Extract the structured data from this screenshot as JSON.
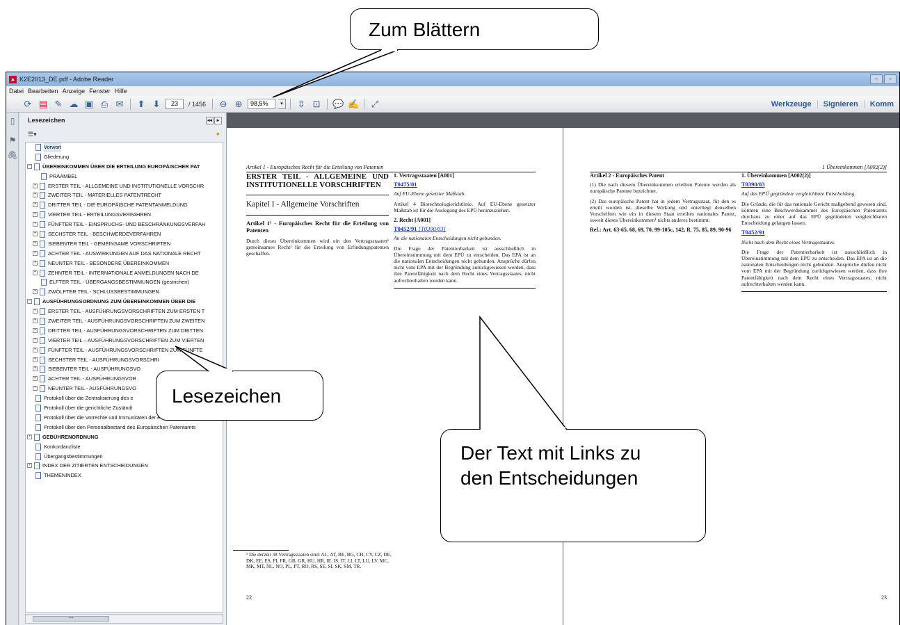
{
  "callouts": {
    "top": "Zum Blättern",
    "bookmarks": "Lesezeichen",
    "text_line1": "Der Text mit Links zu",
    "text_line2": "den Entscheidungen"
  },
  "window": {
    "title": "K2E2013_DE.pdf - Adobe Reader"
  },
  "menu": [
    "Datei",
    "Bearbeiten",
    "Anzeige",
    "Fenster",
    "Hilfe"
  ],
  "toolbar": {
    "page_current": "23",
    "page_total": "/ 1456",
    "zoom": "98,5%",
    "right": [
      "Werkzeuge",
      "Signieren",
      "Komm"
    ]
  },
  "bookmarks": {
    "title": "Lesezeichen",
    "items": [
      {
        "label": "Vorwort",
        "level": 1,
        "exp": "",
        "sel": true
      },
      {
        "label": "Gliederung",
        "level": 1,
        "exp": ""
      },
      {
        "label": "ÜBEREINKOMMEN ÜBER DIE ERTEILUNG EUROPÄISCHER PAT",
        "level": 0,
        "exp": "-",
        "bold": true
      },
      {
        "label": "PRÄAMBEL",
        "level": 2,
        "exp": ""
      },
      {
        "label": "ERSTER TEIL - ALLGEMEINE UND INSTITUTIONELLE VORSCHR",
        "level": 1,
        "exp": "+"
      },
      {
        "label": "ZWEITER TEIL - MATERIELLES PATENTRECHT",
        "level": 1,
        "exp": "+"
      },
      {
        "label": "DRITTER TEIL - DIE EUROPÄISCHE PATENTANMELDUNG",
        "level": 1,
        "exp": "+"
      },
      {
        "label": "VIERTER TEIL - ERTEILUNGSVERFAHREN",
        "level": 1,
        "exp": "+"
      },
      {
        "label": "FÜNFTER TEIL - EINSPRUCHS- UND BESCHRÄNKUNGSVERFAH",
        "level": 1,
        "exp": "+"
      },
      {
        "label": "SECHSTER TEIL - BESCHWERDEVERFAHREN",
        "level": 1,
        "exp": "+"
      },
      {
        "label": "SIEBENTER TEIL - GEMEINSAME VORSCHRIFTEN",
        "level": 1,
        "exp": "+"
      },
      {
        "label": "ACHTER TEIL - AUSWIRKUNGEN AUF DAS NATIONALE RECHT",
        "level": 1,
        "exp": "+"
      },
      {
        "label": "NEUNTER TEIL - BESONDERE ÜBEREINKOMMEN",
        "level": 1,
        "exp": "+"
      },
      {
        "label": "ZEHNTER TEIL - INTERNATIONALE ANMELDUNGEN NACH DE",
        "level": 1,
        "exp": "+"
      },
      {
        "label": "ELFTER TEIL - ÜBERGANGSBESTIMMUNGEN (gestrichen)",
        "level": 2,
        "exp": ""
      },
      {
        "label": "ZWÖLFTER TEIL - SCHLUSSBESTIMMUNGEN",
        "level": 1,
        "exp": "+"
      },
      {
        "label": "AUSFÜHRUNGSORDNUNG ZUM ÜBEREINKOMMEN ÜBER DIE",
        "level": 0,
        "exp": "-",
        "bold": true
      },
      {
        "label": "ERSTER TEIL - AUSFÜHRUNGSVORSCHRIFTEN ZUM ERSTEN T",
        "level": 1,
        "exp": "+"
      },
      {
        "label": "ZWEITER TEIL - AUSFÜHRUNGSVORSCHRIFTEN ZUM ZWEITEN",
        "level": 1,
        "exp": "+"
      },
      {
        "label": "DRITTER TEIL - AUSFÜHRUNGSVORSCHRIFTEN ZUM DRITTEN",
        "level": 1,
        "exp": "+"
      },
      {
        "label": "VIERTER TEIL – AUSFÜHRUNGSVORSCHRIFTEN ZUM VIERTEN",
        "level": 1,
        "exp": "+"
      },
      {
        "label": "FÜNFTER TEIL - AUSFÜHRUNGSVORSCHRIFTEN ZUM FÜNFTE",
        "level": 1,
        "exp": "+"
      },
      {
        "label": "SECHSTER TEIL - AUSFÜHRUNGSVORSCHRI",
        "level": 1,
        "exp": "+"
      },
      {
        "label": "SIEBENTER TEIL - AUSFÜHRUNGSVO",
        "level": 1,
        "exp": "+"
      },
      {
        "label": "ACHTER TEIL - AUSFÜHRUNGSVOR",
        "level": 1,
        "exp": "+"
      },
      {
        "label": "NEUNTER TEIL - AUSFÜHRUNGSVO",
        "level": 1,
        "exp": "+"
      },
      {
        "label": "Protokoll über die Zentralisierung des e",
        "level": 1,
        "exp": ""
      },
      {
        "label": "Protokoll über die gerichtliche Zuständi",
        "level": 1,
        "exp": ""
      },
      {
        "label": "Protokoll über die Vorrechte und Immunitäten der europäischen I",
        "level": 1,
        "exp": ""
      },
      {
        "label": "Protokoll über den Personalbestand des Europäischen Patentamts",
        "level": 1,
        "exp": ""
      },
      {
        "label": "GEBÜHRENORDNUNG",
        "level": 0,
        "exp": "+",
        "bold": true
      },
      {
        "label": "Konkordanzliste",
        "level": 1,
        "exp": ""
      },
      {
        "label": "Übergangsbestimmungen",
        "level": 1,
        "exp": ""
      },
      {
        "label": "INDEX DER ZITIERTEN ENTSCHEIDUNGEN",
        "level": 0,
        "exp": "+"
      },
      {
        "label": "THEMENINDEX",
        "level": 1,
        "exp": ""
      }
    ]
  },
  "page_left": {
    "header": "Artikel 1 - Europäisches Recht für die Erteilung von Patenten",
    "part_title": "ERSTER TEIL - ALLGEMEINE UND INSTITUTIONELLE VORSCHRIFTEN",
    "chapter": "Kapitel I - Allgemeine Vorschriften",
    "article_title": "Artikel 1¹ - Europäisches Recht für die Erteilung von Patenten",
    "article_text": "Durch dieses Übereinkommen wird ein den Vertragsstaaten¹ gemeinsames Recht¹ für die Erteilung von Erfindungspatenten geschaffen.",
    "c1_head": "1. Vertragsstaaten [A001]",
    "c1_link": "T0475/01",
    "c1_italic": "Auf EU-Ebene gesetzter Maßstab.",
    "c1_text": "Artikel 4 Biotechnologierichtlinie. Auf EU-Ebene gesetzter Maßstab ist für die Auslegung des EPÜ heranzuziehen.",
    "c2_head": "2. Recht [A001]",
    "c2_link": "T0452/91",
    "c2_link2": "[T0390/03]",
    "c2_italic": "An die nationalen Entscheidungen nicht gebunden.",
    "c2_text": "Die Frage der Patentierbarkeit ist ausschließlich in Übereinstimmung mit dem EPÜ zu entscheiden. Das EPA ist an die nationalen Entscheidungen nicht gebunden. Ansprüche dürfen nicht vom EPA mit der Begründung zurückgewiesen werden, dass ihre Patentfähigkeit nach dem Recht eines Vertragsstaates, nicht aufrechterhalten werden kann.",
    "footnote": "¹ Die derzeit 38 Vertragsstaaten sind: AL, AT, BE, BG, CH, CY, CZ, DE, DK, EE, ES, FI, FR, GB, GR, HU, HR, IE, IS, IT, LI, LT, LU, LV, MC, MK, MT, NL, NO, PL, PT, RO, RS, SE, SI, SK, SM, TR.",
    "page_number": "22"
  },
  "page_right": {
    "header": "1 Übereinkommen [A002(2)]",
    "a2_title": "Artikel 2 - Europäisches Patent",
    "a2_p1": "(1) Die nach diesem Übereinkommen erteilten Patente werden als europäische Patente bezeichnet.",
    "a2_p2": "(2) Das europäische Patent hat in jedem Vertragsstaat, für den es erteilt worden ist, dieselbe Wirkung und unterliegt denselben Vorschriften wie ein in diesem Staat erteiltes nationales Patent, soweit dieses Übereinkommen¹ nichts anderes bestimmt.",
    "a2_ref": "Ref.: Art. 63-65, 68, 69, 70, 99-105c, 142, R. 75, 85, 89, 90-96",
    "c1_head": "1. Übereinkommen [A002(2)]",
    "c1_link": "T0390/03",
    "c1_italic": "Auf das EPÜ gegründete vergleichbare Entscheidung.",
    "c1_text": "Die Gründe, die für das nationale Gericht maßgebend gewesen sind, könnten eine Beschwerdekammer des Europäischen Patentamts durchaus zu einer auf das EPÜ gegründeten vergleichbaren Entscheidung gelangen lassen.",
    "c2_link": "T0452/91",
    "c2_italic": "Nicht nach dem Recht eines Vertragsstaates.",
    "c2_text": "Die Frage der Patentierbarkeit ist ausschließlich in Übereinstimmung mit dem EPÜ zu entscheiden. Das EPA ist an die nationalen Entscheidungen nicht gebunden. Ansprüche dürfen nicht vom EPA mit der Begründung zurückgewiesen werden, dass ihre Patentfähigkeit nach dem Recht eines Vertragsstaates, nicht aufrechterhalten werden kann.",
    "page_number": "23"
  }
}
